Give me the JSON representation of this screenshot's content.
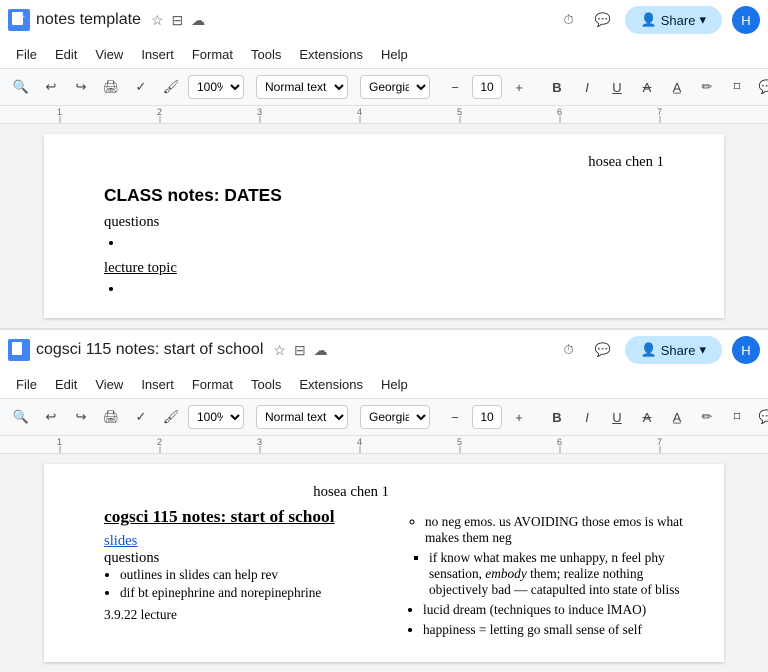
{
  "window1": {
    "doc_icon_letter": "D",
    "title": "notes template",
    "star_icon": "★",
    "folder_icon": "⬚",
    "cloud_icon": "☁",
    "history_icon": "⏱",
    "comment_icon": "💬",
    "share_label": "Share",
    "avatar_letter": "H",
    "menu": [
      "File",
      "Edit",
      "View",
      "Insert",
      "Format",
      "Tools",
      "Extensions",
      "Help"
    ],
    "zoom": "100%",
    "style": "Normal text",
    "font": "Georgia",
    "font_size": "10",
    "header_text": "hosea chen 1",
    "doc_title": "CLASS notes: DATES",
    "questions_label": "questions",
    "lecture_topic_label": "lecture topic"
  },
  "window2": {
    "doc_icon_letter": "D",
    "title": "cogsci 115 notes: start of school",
    "star_icon": "★",
    "folder_icon": "⬚",
    "cloud_icon": "☁",
    "history_icon": "⏱",
    "comment_icon": "💬",
    "share_label": "Share",
    "avatar_letter": "H",
    "menu": [
      "File",
      "Edit",
      "View",
      "Insert",
      "Format",
      "Tools",
      "Extensions",
      "Help"
    ],
    "zoom": "100%",
    "style": "Normal text",
    "font": "Georgia",
    "font_size": "10",
    "header_text": "hosea chen 1",
    "cogsci_title": "cogsci 115 notes: start of school",
    "slides_link": "slides",
    "questions_label": "questions",
    "bullet1": "outlines in slides can help rev",
    "bullet2": "dif bt epinephrine and norepinephrine",
    "lecture_label": "3.9.22 lecture",
    "right_item1": "no neg emos. us AVOIDING those emos is what makes them neg",
    "right_item2": "if know what makes me unhappy, n feel phy sensation, embody them; realize nothing objectively bad — catapulted into state of bliss",
    "right_item3": "lucid dream (techniques to induce lMAO)",
    "right_item4": "happiness = letting go small sense of self"
  }
}
